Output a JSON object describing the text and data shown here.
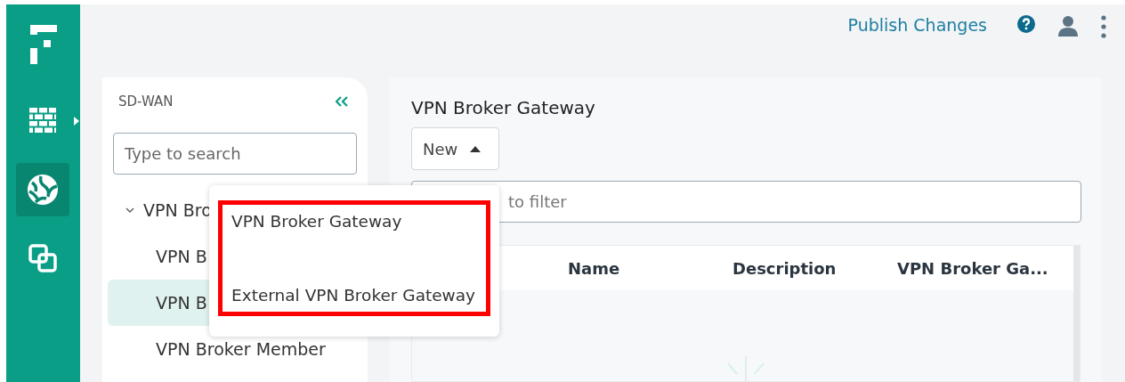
{
  "rail": {
    "items": [
      {
        "kind": "logo"
      },
      {
        "kind": "firewall",
        "selected": false,
        "has_submenu": true
      },
      {
        "kind": "globe",
        "selected": true,
        "has_submenu": false
      },
      {
        "kind": "copy",
        "selected": false,
        "has_submenu": false
      }
    ]
  },
  "header": {
    "publish": "Publish Changes"
  },
  "sidebar": {
    "title": "SD-WAN",
    "search": {
      "placeholder": "Type to search"
    },
    "tree": [
      {
        "label": "VPN Bro",
        "expanded": true,
        "selected": false,
        "children": [
          {
            "label": "VPN B",
            "selected": false
          },
          {
            "label": "VPN B",
            "selected": true
          },
          {
            "label": "VPN Broker Member",
            "selected": false
          }
        ]
      }
    ]
  },
  "main": {
    "title": "VPN Broker Gateway",
    "new_button": {
      "label": "New",
      "expanded": true
    },
    "filter": {
      "placeholder": "to filter"
    },
    "table": {
      "columns": [
        "Name",
        "Description",
        "VPN Broker Ga..."
      ]
    }
  },
  "menu": {
    "highlighted": true,
    "items": [
      "VPN Broker Gateway",
      "External VPN Broker Gateway"
    ]
  }
}
